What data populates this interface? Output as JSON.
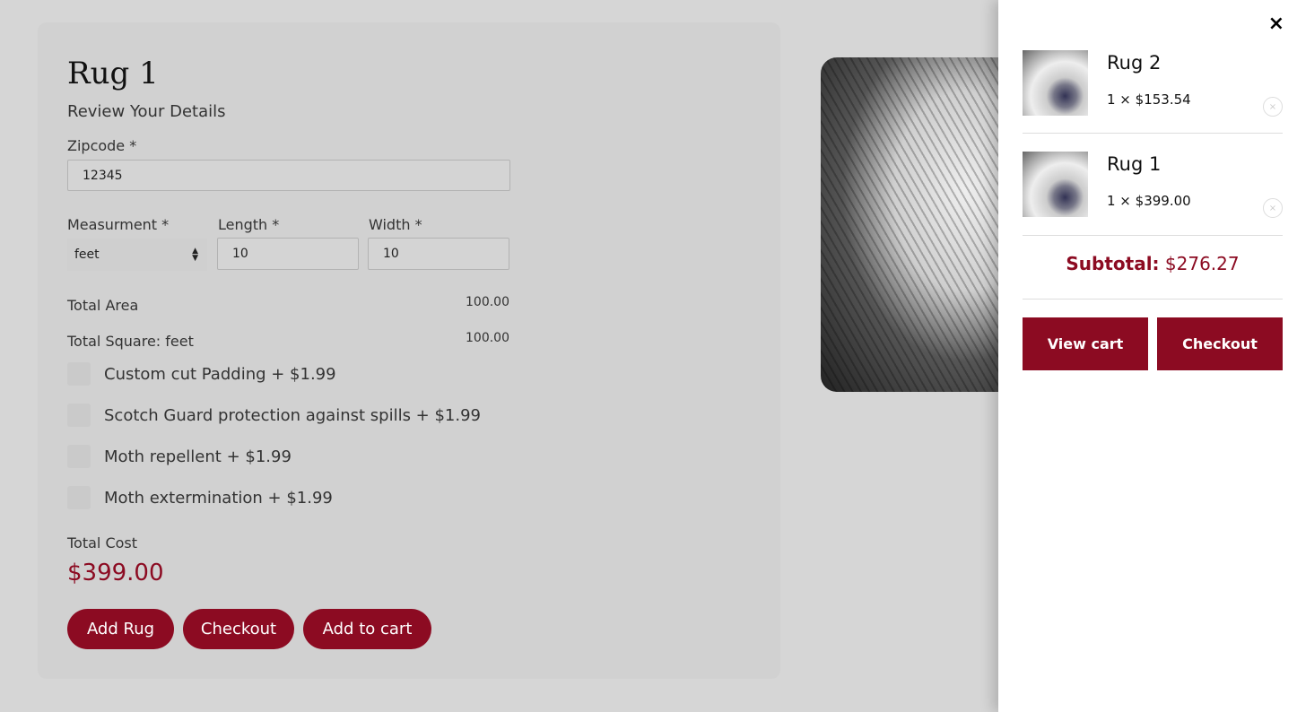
{
  "form": {
    "title": "Rug 1",
    "subtitle": "Review Your Details",
    "zipcode_label": "Zipcode *",
    "zipcode_value": "12345",
    "measurement_label": "Measurment *",
    "measurement_value": "feet",
    "length_label": "Length *",
    "length_value": "10",
    "width_label": "Width *",
    "width_value": "10",
    "total_area_label": "Total Area",
    "total_area_value": "100.00",
    "total_square_label": "Total Square: feet",
    "total_square_value": "100.00",
    "options": [
      {
        "label": "Custom cut Padding + $1.99"
      },
      {
        "label": "Scotch Guard protection against spills + $1.99"
      },
      {
        "label": "Moth repellent + $1.99"
      },
      {
        "label": "Moth extermination + $1.99"
      }
    ],
    "total_cost_label": "Total Cost",
    "total_cost_value": "$399.00",
    "buttons": {
      "add_rug": "Add Rug",
      "checkout": "Checkout",
      "add_to_cart": "Add to cart"
    }
  },
  "cart": {
    "close": "×",
    "items": [
      {
        "name": "Rug 2",
        "qty_price": "1 × $153.54"
      },
      {
        "name": "Rug 1",
        "qty_price": "1 × $399.00"
      }
    ],
    "subtotal_label": "Subtotal:",
    "subtotal_value": "$276.27",
    "view_cart": "View cart",
    "checkout": "Checkout"
  },
  "colors": {
    "accent": "#8c0b22"
  }
}
